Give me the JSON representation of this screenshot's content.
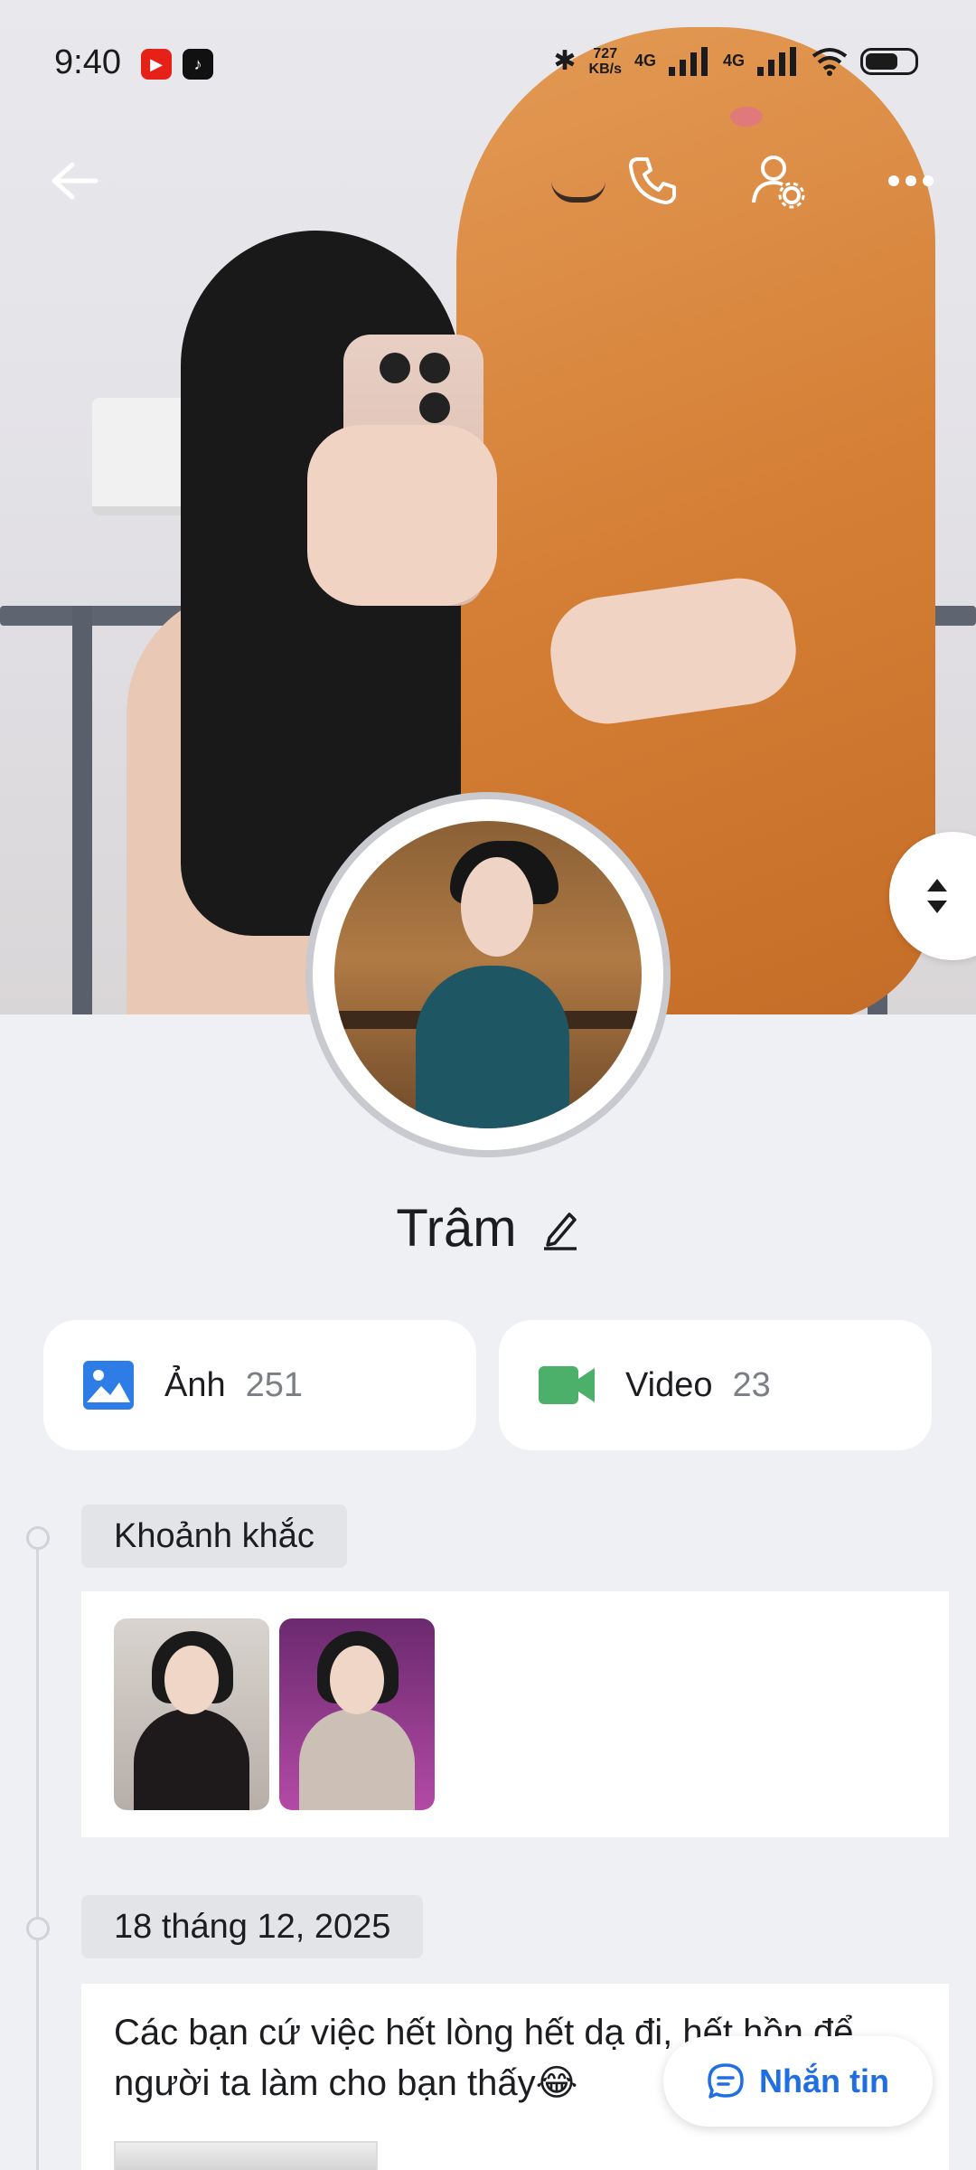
{
  "status_bar": {
    "time": "9:40",
    "net_speed_value": "727",
    "net_speed_unit": "KB/s",
    "signal_1": "4G",
    "signal_2": "4G"
  },
  "profile": {
    "name": "Trâm"
  },
  "media": {
    "photos_label": "Ảnh",
    "photos_count": "251",
    "videos_label": "Video",
    "videos_count": "23"
  },
  "timeline": {
    "moments_label": "Khoảnh khắc",
    "post_date": "18 tháng 12, 2025",
    "post_text": "Các bạn cứ việc hết lòng hết dạ đi, hết hồn để người ta làm cho bạn thấy😂"
  },
  "actions": {
    "message_label": "Nhắn tin"
  },
  "colors": {
    "accent_blue": "#1f6fe0",
    "video_green": "#4caf6a",
    "photo_blue": "#2e7de6"
  }
}
